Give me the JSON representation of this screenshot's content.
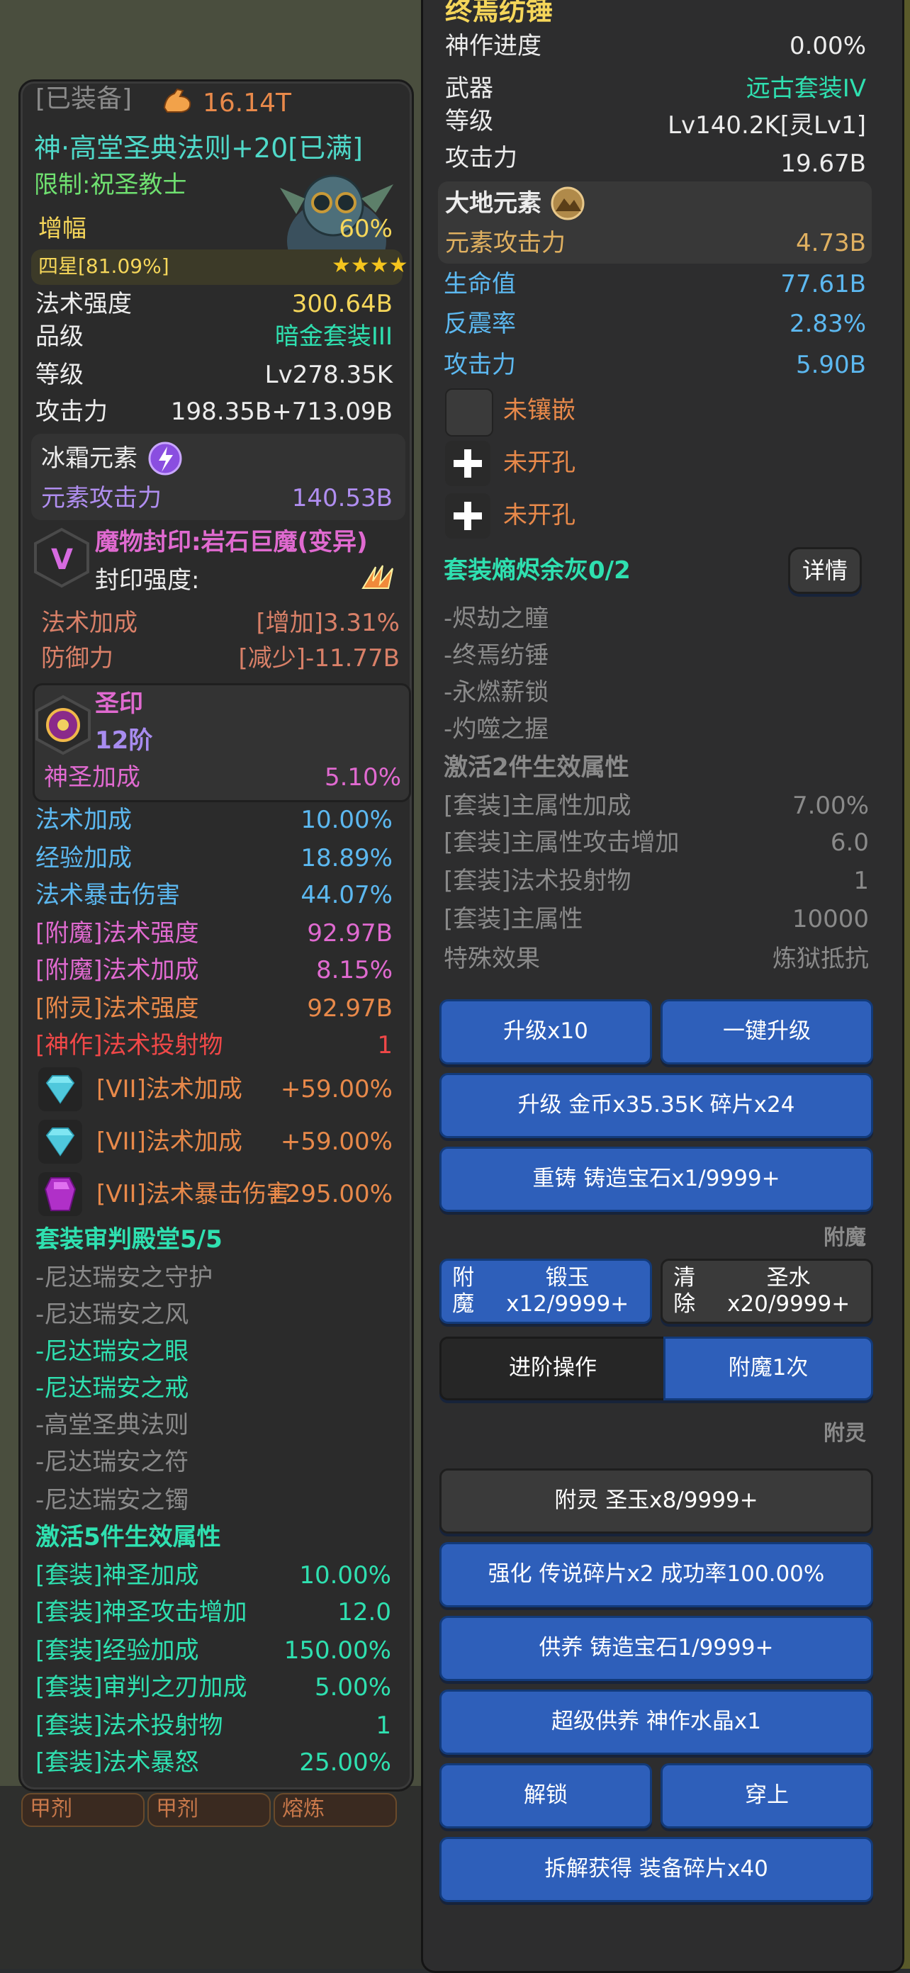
{
  "left": {
    "equipped_tag": "[已装备]",
    "power": "16.14T",
    "item_name": "神·高堂圣典法则+20[已满]",
    "restriction": "限制:祝圣教士",
    "amp": {
      "label": "增幅",
      "value": "60%",
      "star_label": "四星[81.09%]",
      "stars": 4
    },
    "spell_power": {
      "label": "法术强度",
      "value": "300.64B"
    },
    "grade": {
      "label": "品级",
      "value": "暗金套装III"
    },
    "level": {
      "label": "等级",
      "value": "Lv278.35K"
    },
    "attack": {
      "label": "攻击力",
      "value": "198.35B+713.09B"
    },
    "element": {
      "label": "冰霜元素",
      "attack_label": "元素攻击力",
      "attack_value": "140.53B"
    },
    "seal": {
      "badge": "V",
      "title": "魔物封印:岩石巨魔(变异)",
      "strength_label": "封印强度:",
      "rows": [
        {
          "label": "法术加成",
          "value": "[增加]3.31%"
        },
        {
          "label": "防御力",
          "value": "[减少]-11.77B"
        }
      ]
    },
    "holy": {
      "title": "圣印",
      "tier": "12阶",
      "label": "神圣加成",
      "value": "5.10%"
    },
    "stats": [
      {
        "label": "法术加成",
        "value": "10.00%",
        "color": "blue"
      },
      {
        "label": "经验加成",
        "value": "18.89%",
        "color": "blue"
      },
      {
        "label": "法术暴击伤害",
        "value": "44.07%",
        "color": "blue"
      },
      {
        "label": "[附魔]法术强度",
        "value": "92.97B",
        "color": "pink"
      },
      {
        "label": "[附魔]法术加成",
        "value": "8.15%",
        "color": "pink"
      },
      {
        "label": "[附灵]法术强度",
        "value": "92.97B",
        "color": "orange"
      },
      {
        "label": "[神作]法术投射物",
        "value": "1",
        "color": "red"
      }
    ],
    "gems": [
      {
        "label": "[VII]法术加成",
        "value": "+59.00%",
        "gem": "diamond-gem-icon"
      },
      {
        "label": "[VII]法术加成",
        "value": "+59.00%",
        "gem": "diamond-gem-icon"
      },
      {
        "label": "[VII]法术暴击伤害",
        "value": "+295.00%",
        "gem": "purple-gem-icon"
      }
    ],
    "set": {
      "title": "套装审判殿堂5/5",
      "pieces": [
        {
          "name": "-尼达瑞安之守护",
          "active": false
        },
        {
          "name": "-尼达瑞安之风",
          "active": false
        },
        {
          "name": "-尼达瑞安之眼",
          "active": true
        },
        {
          "name": "-尼达瑞安之戒",
          "active": true
        },
        {
          "name": "-高堂圣典法则",
          "active": false
        },
        {
          "name": "-尼达瑞安之符",
          "active": false
        },
        {
          "name": "-尼达瑞安之镯",
          "active": false
        }
      ],
      "activate_title": "激活5件生效属性",
      "bonuses": [
        {
          "label": "[套装]神圣加成",
          "value": "10.00%"
        },
        {
          "label": "[套装]神圣攻击增加",
          "value": "12.0"
        },
        {
          "label": "[套装]经验加成",
          "value": "150.00%"
        },
        {
          "label": "[套装]审判之刃加成",
          "value": "5.00%"
        },
        {
          "label": "[套装]法术投射物",
          "value": "1"
        },
        {
          "label": "[套装]法术暴怒",
          "value": "25.00%"
        }
      ]
    },
    "bottom_tabs": [
      "甲剂",
      "甲剂",
      "熔炼"
    ]
  },
  "right": {
    "item_title": "终焉纺锤",
    "progress": {
      "label": "神作进度",
      "value": "0.00%"
    },
    "weapon": {
      "label": "武器",
      "value": "远古套装IV"
    },
    "level": {
      "label": "等级",
      "value": "Lv140.2K[灵Lv1]"
    },
    "attack": {
      "label": "攻击力",
      "value": "19.67B"
    },
    "element": {
      "label": "大地元素",
      "attack_label": "元素攻击力",
      "attack_value": "4.73B"
    },
    "stats": [
      {
        "label": "生命值",
        "value": "77.61B"
      },
      {
        "label": "反震率",
        "value": "2.83%"
      },
      {
        "label": "攻击力",
        "value": "5.90B"
      }
    ],
    "sockets": [
      "未镶嵌",
      "未开孔",
      "未开孔"
    ],
    "set": {
      "title": "套装熵烬余灰0/2",
      "detail_button": "详情",
      "pieces": [
        "-烬劫之瞳",
        "-终焉纺锤",
        "-永燃薪锁",
        "-灼噬之握"
      ],
      "activate_title": "激活2件生效属性",
      "bonuses": [
        {
          "label": "[套装]主属性加成",
          "value": "7.00%"
        },
        {
          "label": "[套装]主属性攻击增加",
          "value": "6.0"
        },
        {
          "label": "[套装]法术投射物",
          "value": "1"
        },
        {
          "label": "[套装]主属性",
          "value": "10000"
        },
        {
          "label": "特殊效果",
          "value": "炼狱抵抗"
        }
      ]
    },
    "buttons": {
      "upgrade_x10": "升级x10",
      "one_key_upgrade": "一键升级",
      "upgrade_cost": "升级 金币x35.35K 碎片x24",
      "reforge": "重铸 铸造宝石x1/9999+",
      "enchant_section": "附魔",
      "enchant_line1": "附魔",
      "enchant_line2": "锻玉x12/9999+",
      "clear_line1": "清除",
      "clear_line2": "圣水x20/9999+",
      "advanced": "进阶操作",
      "enchant_once": "附魔1次",
      "spirit_section": "附灵",
      "spirit": "附灵 圣玉x8/9999+",
      "strengthen": "强化 传说碎片x2 成功率100.00%",
      "nurture": "供养 铸造宝石1/9999+",
      "super_nurture": "超级供养 神作水晶x1",
      "unlock": "解锁",
      "wear": "穿上",
      "dismantle": "拆解获得 装备碎片x40"
    }
  },
  "colors": {
    "button_blue": "#2e5fba",
    "set_green": "#2fe0b0",
    "stat_blue": "#5cb8f0"
  }
}
